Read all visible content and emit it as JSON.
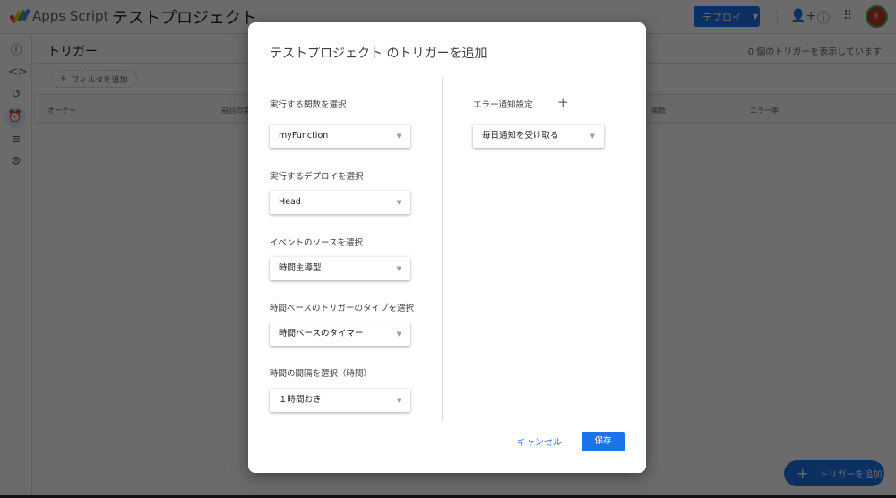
{
  "header": {
    "app_name": "Apps Script",
    "project_title": "テストプロジェクト",
    "deploy_label": "デプロイ"
  },
  "page": {
    "title": "トリガー",
    "count_text": "0 個のトリガーを表示しています",
    "filter_label": "フィルタを追加",
    "columns": [
      "オーナー",
      "前回の実",
      "関数",
      "エラー率"
    ],
    "fab_label": "トリガーを追加"
  },
  "dialog": {
    "title": "テストプロジェクト のトリガーを追加",
    "fields": [
      {
        "label": "実行する関数を選択",
        "value": "myFunction"
      },
      {
        "label": "実行するデプロイを選択",
        "value": "Head"
      },
      {
        "label": "イベントのソースを選択",
        "value": "時間主導型"
      },
      {
        "label": "時間ベースのトリガーのタイプを選択",
        "value": "時間ベースのタイマー"
      },
      {
        "label": "時間の間隔を選択（時間）",
        "value": "１時間おき"
      }
    ],
    "notify": {
      "label": "エラー通知設定",
      "value": "毎日通知を受け取る"
    },
    "cancel_label": "キャンセル",
    "save_label": "保存"
  },
  "colors": {
    "accent": "#1a73e8"
  }
}
